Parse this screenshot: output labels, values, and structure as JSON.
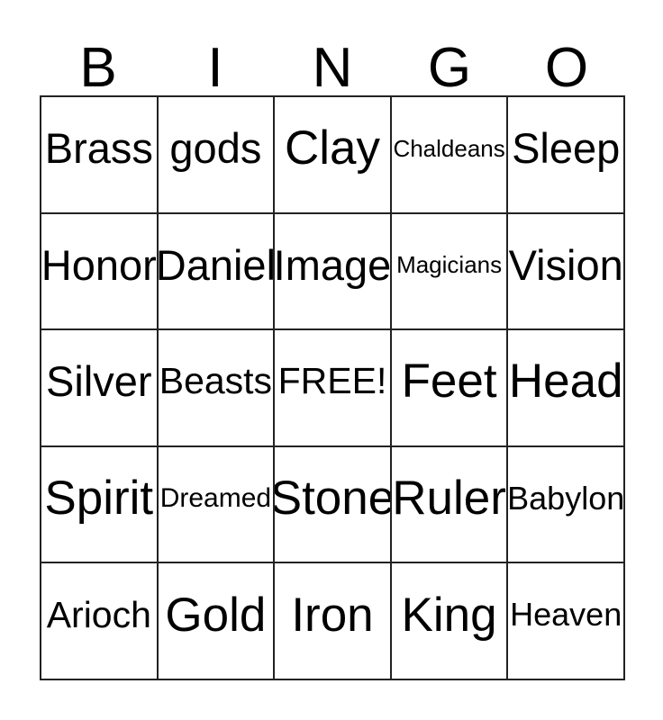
{
  "card": {
    "title": "BINGO Card",
    "header_letters": [
      "B",
      "I",
      "N",
      "G",
      "O"
    ],
    "free_space_label": "FREE!",
    "colors": {
      "background": "#ffffff",
      "border": "#222222",
      "text": "#000000"
    },
    "grid": {
      "columns": 5,
      "rows": 5
    },
    "rows": [
      [
        {
          "label": "Brass",
          "size": "lg"
        },
        {
          "label": "gods",
          "size": "lg"
        },
        {
          "label": "Clay",
          "size": "xl"
        },
        {
          "label": "Chaldeans",
          "size": "xxs"
        },
        {
          "label": "Sleep",
          "size": "lg"
        }
      ],
      [
        {
          "label": "Honor",
          "size": "lg"
        },
        {
          "label": "Daniel",
          "size": "lg"
        },
        {
          "label": "Image",
          "size": "lg"
        },
        {
          "label": "Magicians",
          "size": "xxs"
        },
        {
          "label": "Vision",
          "size": "lg"
        }
      ],
      [
        {
          "label": "Silver",
          "size": "lg"
        },
        {
          "label": "Beasts",
          "size": "md"
        },
        {
          "label": "FREE!",
          "size": "md"
        },
        {
          "label": "Feet",
          "size": "xl"
        },
        {
          "label": "Head",
          "size": "xl"
        }
      ],
      [
        {
          "label": "Spirit",
          "size": "xl"
        },
        {
          "label": "Dreamed",
          "size": "xs"
        },
        {
          "label": "Stone",
          "size": "xl"
        },
        {
          "label": "Ruler",
          "size": "xl"
        },
        {
          "label": "Babylon",
          "size": "sm"
        }
      ],
      [
        {
          "label": "Arioch",
          "size": "md"
        },
        {
          "label": "Gold",
          "size": "xl"
        },
        {
          "label": "Iron",
          "size": "xl"
        },
        {
          "label": "King",
          "size": "xl"
        },
        {
          "label": "Heaven",
          "size": "sm"
        }
      ]
    ]
  }
}
